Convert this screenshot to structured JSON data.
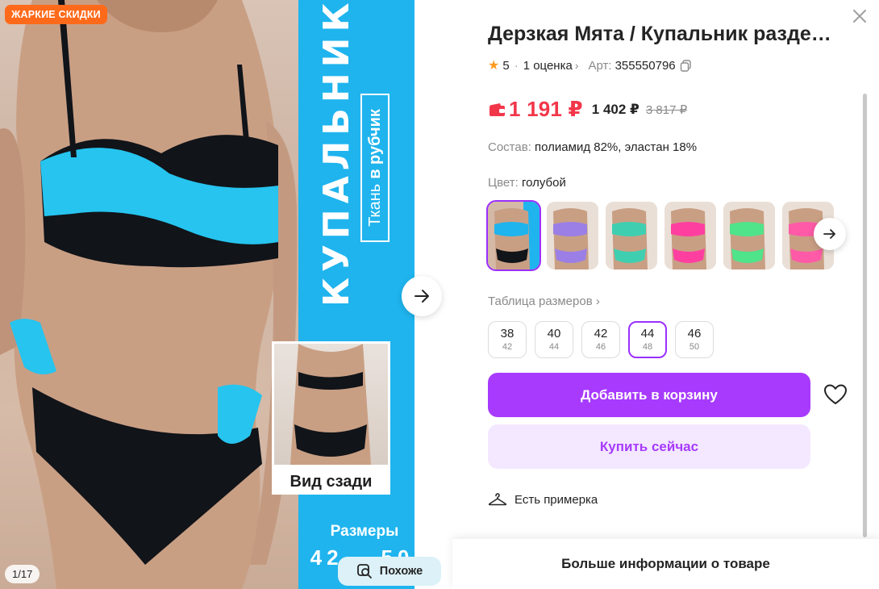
{
  "photo": {
    "badge": "ЖАРКИЕ СКИДКИ",
    "promo_title": "КУПАЛЬНИК",
    "promo_sub_prefix": "Ткань",
    "promo_sub_bold": "в рубчик",
    "back_view_label": "Вид сзади",
    "sizes_label": "Размеры",
    "sizes_range": "42 – 50",
    "counter": "1/17",
    "similar_label": "Похоже",
    "colors": {
      "band": "#1fb4ee",
      "badge": "#ff6a1a"
    }
  },
  "product": {
    "title": "Дерзкая Мята / Купальник раздельный",
    "rating": "5",
    "reviews": "1 оценка",
    "article_label": "Арт:",
    "article": "355550796",
    "price_main": "1 191 ₽",
    "price_mid": "1 402 ₽",
    "price_old": "3 817 ₽",
    "composition_label": "Состав:",
    "composition_value": "полиамид 82%, эластан 18%",
    "color_label": "Цвет:",
    "color_value": "голубой",
    "size_table_link": "Таблица размеров",
    "sizes": [
      {
        "ru": "38",
        "alt": "42",
        "selected": false
      },
      {
        "ru": "40",
        "alt": "44",
        "selected": false
      },
      {
        "ru": "42",
        "alt": "46",
        "selected": false
      },
      {
        "ru": "44",
        "alt": "48",
        "selected": true
      },
      {
        "ru": "46",
        "alt": "50",
        "selected": false
      }
    ],
    "thumbnail_colors": [
      "#1fb4ee",
      "#9b7fe6",
      "#3fcfb0",
      "#ff3fa0",
      "#4fe38a",
      "#ff5aa8"
    ],
    "add_to_cart": "Добавить в корзину",
    "buy_now": "Купить сейчас",
    "try_on": "Есть примерка",
    "more_info": "Больше информации о товаре",
    "colors": {
      "accent": "#a73afd",
      "price": "#f2364a"
    }
  }
}
